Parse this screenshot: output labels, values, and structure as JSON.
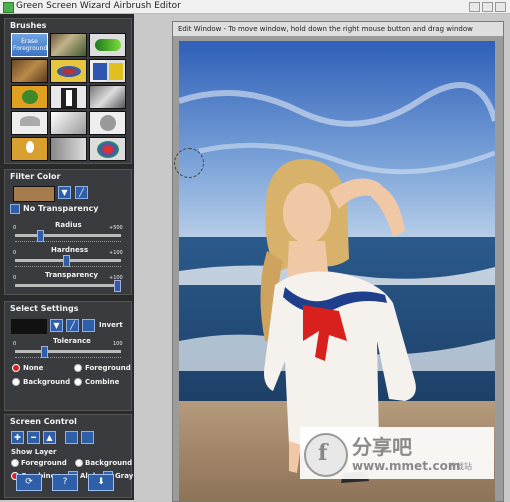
{
  "window": {
    "title": "Green Screen Wizard Airbrush Editor"
  },
  "brushes": {
    "heading": "Brushes",
    "items": [
      {
        "name": "erase-foreground",
        "label": "Erase Foreground"
      },
      {
        "name": "brush-2",
        "label": ""
      },
      {
        "name": "brush-3",
        "label": ""
      },
      {
        "name": "brush-4",
        "label": ""
      },
      {
        "name": "brush-5",
        "label": ""
      },
      {
        "name": "brush-6",
        "label": ""
      },
      {
        "name": "brush-7",
        "label": ""
      },
      {
        "name": "brush-8",
        "label": ""
      },
      {
        "name": "brush-9",
        "label": ""
      },
      {
        "name": "brush-10",
        "label": ""
      },
      {
        "name": "brush-11",
        "label": ""
      },
      {
        "name": "brush-12",
        "label": ""
      },
      {
        "name": "brush-13",
        "label": ""
      },
      {
        "name": "brush-14",
        "label": ""
      },
      {
        "name": "brush-15",
        "label": ""
      }
    ]
  },
  "filter_color": {
    "heading": "Filter Color",
    "swatch_color": "#a67c4c",
    "no_transparency": "No Transparency",
    "radius": {
      "label": "Radius",
      "min": "0",
      "max": "+500",
      "value": 0.23
    },
    "hardness": {
      "label": "Hardness",
      "min": "0",
      "max": "+100",
      "value": 0.48
    },
    "transparency": {
      "label": "Transparency",
      "min": "0",
      "max": "+100",
      "value": 0.97
    }
  },
  "select_settings": {
    "heading": "Select Settings",
    "invert": "Invert",
    "tolerance": {
      "label": "Tolerance",
      "min": "0",
      "max": "100",
      "value": 0.27
    },
    "options": {
      "none": "None",
      "foreground": "Foreground",
      "background": "Background",
      "combine": "Combine"
    },
    "selected": "None"
  },
  "screen_control": {
    "heading": "Screen Control",
    "show_layer": "Show Layer",
    "layers": {
      "foreground": "Foreground",
      "background": "Background",
      "combine": "Combine",
      "alpha": "Alpha",
      "gray": "Gray"
    },
    "selected_layer": "Combine"
  },
  "edit_window": {
    "title": "Edit Window - To move window, hold down the right mouse button and drag window"
  },
  "watermark": {
    "text": "分享吧",
    "domain": "www.mmet.com",
    "sub": "下载站"
  },
  "colors": {
    "accent": "#2f5fa8",
    "panel": "#393b3e",
    "selected_radio": "#e02020"
  }
}
